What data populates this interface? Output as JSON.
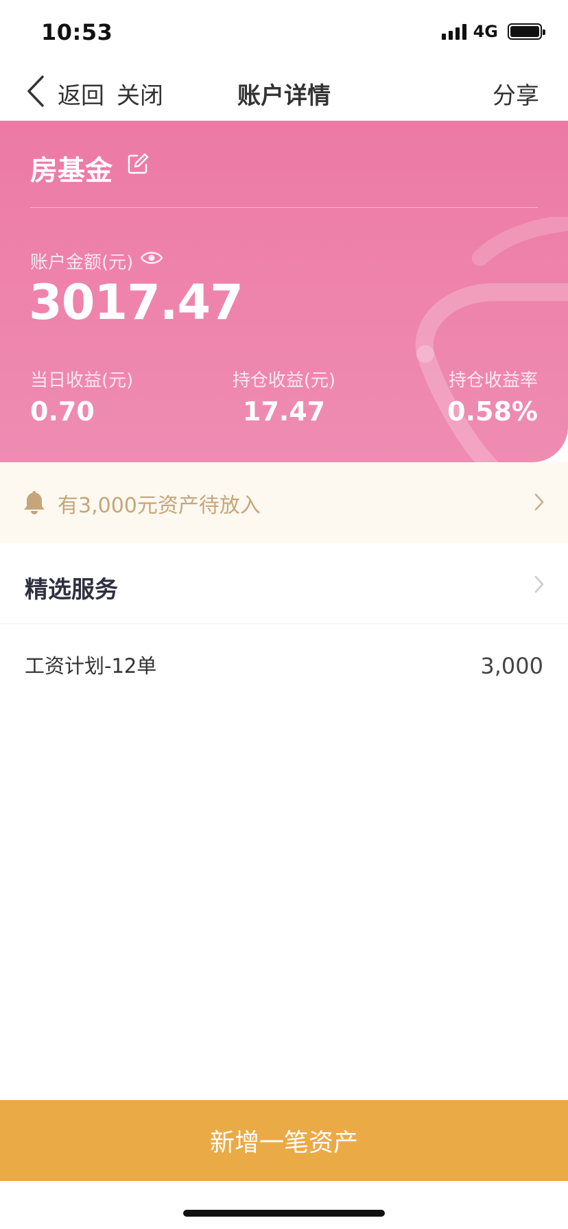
{
  "status_bar": {
    "time": "10:53",
    "network": "4G",
    "icons": [
      "signal-icon",
      "battery-icon"
    ]
  },
  "nav": {
    "back_label": "返回",
    "close_label": "关闭",
    "title": "账户详情",
    "share_label": "分享",
    "back_icon": "chevron-left-icon"
  },
  "account": {
    "name": "房基金",
    "edit_icon": "edit-icon",
    "amount_label": "账户金额(元)",
    "visibility_icon": "eye-icon",
    "amount": "3017.47",
    "stats": [
      {
        "label": "当日收益(元)",
        "value": "0.70"
      },
      {
        "label": "持仓收益(元)",
        "value": "17.47"
      },
      {
        "label": "持仓收益率",
        "value": "0.58%"
      }
    ]
  },
  "notice": {
    "icon": "bell-icon",
    "text": "有3,000元资产待放入"
  },
  "services": {
    "title": "精选服务",
    "items": [
      {
        "name": "工资计划-12单",
        "amount": "3,000"
      }
    ]
  },
  "footer": {
    "add_button_label": "新增一笔资产"
  },
  "colors": {
    "card_pink": "#ec7aa4",
    "notice_bg": "#fdf9f0",
    "notice_text": "#c6a57a",
    "button_orange": "#eaaa45"
  }
}
